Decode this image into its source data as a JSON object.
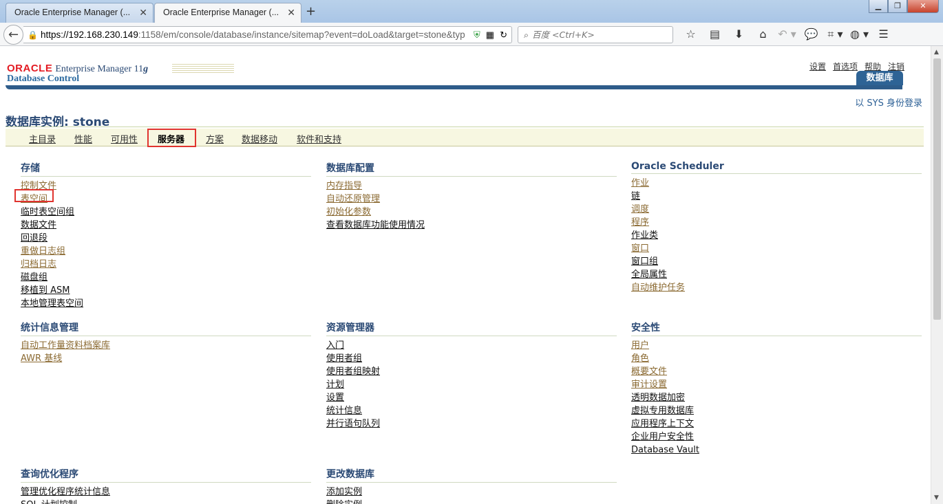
{
  "browser": {
    "tabs": [
      {
        "title": "Oracle Enterprise Manager (...",
        "active": false
      },
      {
        "title": "Oracle Enterprise Manager (...",
        "active": true
      }
    ],
    "url_host": "https://192.168.230.149",
    "url_rest": ":1158/em/console/database/instance/sitemap?event=doLoad&target=stone&typ",
    "search_placeholder": "百度 <Ctrl+K>"
  },
  "header": {
    "oracle": "ORACLE",
    "em_text": "Enterprise Manager 11",
    "em_g": "g",
    "dbcontrol": "Database Control",
    "global_links": [
      "设置",
      "首选项",
      "帮助",
      "注销"
    ],
    "db_tab": "数据库",
    "login_as": "以 SYS 身份登录"
  },
  "page_title": "数据库实例: stone",
  "subtabs": [
    {
      "label": "主目录",
      "selected": false
    },
    {
      "label": "性能",
      "selected": false
    },
    {
      "label": "可用性",
      "selected": false
    },
    {
      "label": "服务器",
      "selected": true
    },
    {
      "label": "方案",
      "selected": false
    },
    {
      "label": "数据移动",
      "selected": false
    },
    {
      "label": "软件和支持",
      "selected": false
    }
  ],
  "sections": {
    "storage": {
      "title": "存储",
      "links": [
        {
          "label": "控制文件",
          "visited": true
        },
        {
          "label": "表空间",
          "visited": true,
          "highlighted": true
        },
        {
          "label": "临时表空间组",
          "visited": false
        },
        {
          "label": "数据文件",
          "visited": false
        },
        {
          "label": "回退段",
          "visited": false
        },
        {
          "label": "重做日志组",
          "visited": true
        },
        {
          "label": "归档日志",
          "visited": true
        },
        {
          "label": "磁盘组",
          "visited": false
        },
        {
          "label": "移植到 ASM",
          "visited": false
        },
        {
          "label": "本地管理表空间",
          "visited": false
        }
      ]
    },
    "dbconfig": {
      "title": "数据库配置",
      "links": [
        {
          "label": "内存指导",
          "visited": true
        },
        {
          "label": "自动还原管理",
          "visited": true
        },
        {
          "label": "初始化参数",
          "visited": true
        },
        {
          "label": "查看数据库功能使用情况",
          "visited": false
        }
      ]
    },
    "scheduler": {
      "title": "Oracle Scheduler",
      "links": [
        {
          "label": "作业",
          "visited": true
        },
        {
          "label": "链",
          "visited": false
        },
        {
          "label": "调度",
          "visited": true
        },
        {
          "label": "程序",
          "visited": true
        },
        {
          "label": "作业类",
          "visited": false
        },
        {
          "label": "窗口",
          "visited": true
        },
        {
          "label": "窗口组",
          "visited": false
        },
        {
          "label": "全局属性",
          "visited": false
        },
        {
          "label": "自动维护任务",
          "visited": true
        }
      ]
    },
    "stats": {
      "title": "统计信息管理",
      "links": [
        {
          "label": "自动工作量资料档案库",
          "visited": true
        },
        {
          "label": "AWR 基线",
          "visited": true
        }
      ]
    },
    "resource": {
      "title": "资源管理器",
      "links": [
        {
          "label": "入门",
          "visited": false
        },
        {
          "label": "使用者组",
          "visited": false
        },
        {
          "label": "使用者组映射",
          "visited": false
        },
        {
          "label": "计划",
          "visited": false
        },
        {
          "label": "设置",
          "visited": false
        },
        {
          "label": "统计信息",
          "visited": false
        },
        {
          "label": "并行语句队列",
          "visited": false
        }
      ]
    },
    "security": {
      "title": "安全性",
      "links": [
        {
          "label": "用户",
          "visited": true
        },
        {
          "label": "角色",
          "visited": true
        },
        {
          "label": "概要文件",
          "visited": true
        },
        {
          "label": "审计设置",
          "visited": true
        },
        {
          "label": "透明数据加密",
          "visited": false
        },
        {
          "label": "虚拟专用数据库",
          "visited": false
        },
        {
          "label": "应用程序上下文",
          "visited": false
        },
        {
          "label": "企业用户安全性",
          "visited": false
        },
        {
          "label": "Database Vault",
          "visited": false
        }
      ]
    },
    "query": {
      "title": "查询优化程序",
      "links": [
        {
          "label": "管理优化程序统计信息",
          "visited": false
        },
        {
          "label": "SQL 计划控制",
          "visited": false
        }
      ]
    },
    "changedb": {
      "title": "更改数据库",
      "links": [
        {
          "label": "添加实例",
          "visited": false
        },
        {
          "label": "删除实例",
          "visited": false
        }
      ]
    }
  },
  "colors": {
    "visited_link": "#8b6a32",
    "link": "#111111",
    "header_blue": "#2e5c8a",
    "highlight_red": "#e0342f"
  }
}
